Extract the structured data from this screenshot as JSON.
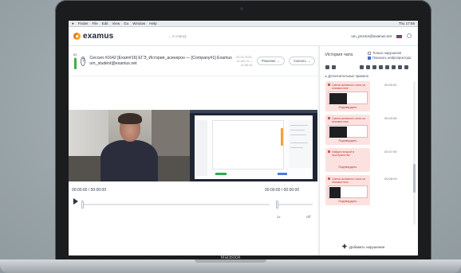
{
  "menubar": {
    "items": [
      "Finder",
      "File",
      "Edit",
      "View",
      "Go",
      "Window",
      "Help"
    ],
    "status": "Thu 17:56"
  },
  "header": {
    "logo": "examus",
    "back": "← К списку",
    "user_email": "um_proctor@examus.net"
  },
  "session": {
    "score": "85",
    "score_fraction": 0.85,
    "title": "Сессия #1642 [Exam#16] ЕГЭ_История_асинхрон — [Company#1] Examus",
    "email": "um_student@examus.net",
    "date": "03.02.2021, 11:45:23 — 11:58:01",
    "button_decision": "Решение",
    "button_download": "Скачать"
  },
  "timeline": {
    "left_time": "00:00:00 / 00:00:00",
    "right_time": "00:00:00 / 00:00:00",
    "speed_left": "1x",
    "speed_right": "Off"
  },
  "history": {
    "title": "История чата",
    "filter_only": "Только нарушения",
    "filter_show": "Показать нейропроктора",
    "extra_rules": "▸ Дополнительные правила",
    "add_violation": "Добавить нарушение",
    "events": [
      {
        "title": "Смена активного окна на неизвестное",
        "time": "00:00:51",
        "confirm": "Подтвердить"
      },
      {
        "title": "Смена активного окна на неизвестное",
        "time": "00:00:55",
        "confirm": "Подтвердить"
      },
      {
        "title": "Найден второй в пространстве",
        "time": "00:07:59",
        "confirm": "Подтвердить"
      },
      {
        "title": "Смена активного окна на неизвестное",
        "time": "00:08:09",
        "confirm": "Подтвердить"
      }
    ]
  },
  "laptop": {
    "brand": "MacBook"
  }
}
